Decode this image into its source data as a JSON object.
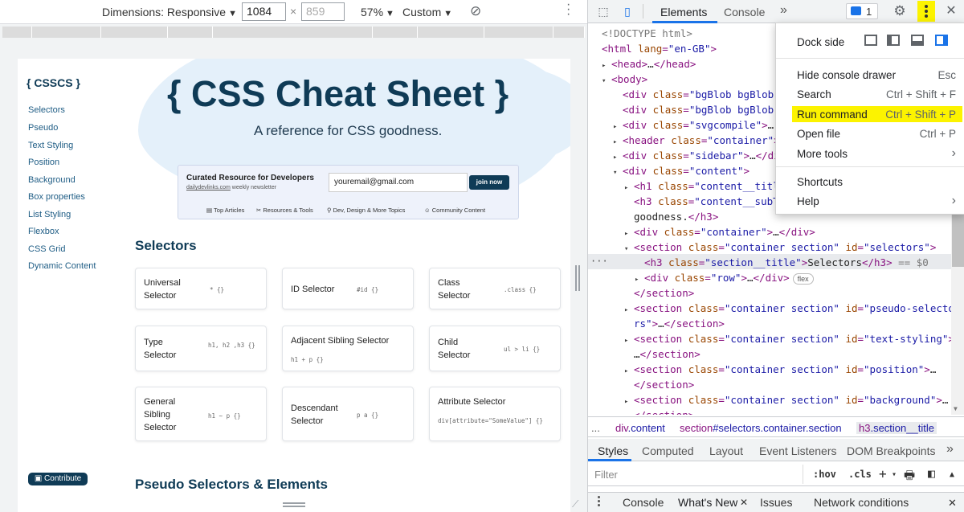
{
  "device_toolbar": {
    "dimensions_label": "Dimensions: Responsive",
    "width_value": "1084",
    "height_placeholder": "859",
    "times": "×",
    "zoom": "57%",
    "throttle": "Custom"
  },
  "site": {
    "logo": "{ CSSCS }",
    "sidebar": [
      "Selectors",
      "Pseudo",
      "Text Styling",
      "Position",
      "Background",
      "Box properties",
      "List Styling",
      "Flexbox",
      "CSS Grid",
      "Dynamic Content"
    ],
    "title": "{ CSS Cheat Sheet }",
    "subtitle": "A reference for CSS goodness.",
    "newsletter": {
      "title": "Curated Resource for Developers",
      "desc_link": "dailydevlinks.com",
      "desc_rest": " weekly newsletter",
      "email_value": "youremail@gmail.com",
      "button": "join now",
      "links": [
        "Top Articles",
        "Resources & Tools",
        "Dev, Design & More Topics",
        "Community Content"
      ]
    },
    "section_selectors": "Selectors",
    "cards": [
      {
        "name": "Universal Selector",
        "code": "* {}"
      },
      {
        "name": "ID Selector",
        "code": "#id {}"
      },
      {
        "name": "Class Selector",
        "code": ".class {}"
      },
      {
        "name": "Type Selector",
        "code": "h1, h2 ,h3 {}"
      },
      {
        "name": "Adjacent Sibling Selector",
        "code": "h1 + p {}"
      },
      {
        "name": "Child Selector",
        "code": "ul > li {}"
      },
      {
        "name": "General Sibling Selector",
        "code": "h1 ~ p {}"
      },
      {
        "name": "Descendant Selector",
        "code": "p a {}"
      },
      {
        "name": "Attribute Selector",
        "code": "div[attribute=\"SomeValue\"] {}"
      }
    ],
    "section_pseudo": "Pseudo Selectors & Elements",
    "contribute": "Contribute"
  },
  "devtools": {
    "tabs": [
      "Elements",
      "Console"
    ],
    "more_tabs": "»",
    "issues_count": "1",
    "close": "✕",
    "menu": {
      "dock_side": "Dock side",
      "items": [
        {
          "label": "Hide console drawer",
          "shortcut": "Esc"
        },
        {
          "label": "Search",
          "shortcut": "Ctrl + Shift + F"
        },
        {
          "label": "Run command",
          "shortcut": "Ctrl + Shift + P"
        },
        {
          "label": "Open file",
          "shortcut": "Ctrl + P"
        },
        {
          "label": "More tools",
          "shortcut": "›"
        },
        {
          "label": "Shortcuts",
          "shortcut": ""
        },
        {
          "label": "Help",
          "shortcut": "›"
        }
      ]
    },
    "code": [
      {
        "tri": "",
        "indent": 0,
        "parts": [
          [
            "cmt",
            "<!DOCTYPE html>"
          ]
        ]
      },
      {
        "tri": "",
        "indent": 0,
        "parts": [
          [
            "tag",
            "<html "
          ],
          [
            "attr",
            "lang"
          ],
          [
            "tag",
            "="
          ],
          [
            "val",
            "\"en-GB\""
          ],
          [
            "tag",
            ">"
          ]
        ]
      },
      {
        "tri": "▸",
        "indent": 1,
        "parts": [
          [
            "tag",
            "<head>"
          ],
          [
            "txt",
            "…"
          ],
          [
            "tag",
            "</head>"
          ]
        ]
      },
      {
        "tri": "▾",
        "indent": 1,
        "parts": [
          [
            "tag",
            "<body>"
          ]
        ]
      },
      {
        "tri": "",
        "indent": 2,
        "parts": [
          [
            "tag",
            "<div "
          ],
          [
            "attr",
            "class"
          ],
          [
            "tag",
            "="
          ],
          [
            "val",
            "\"bgBlob bgBlob-"
          ]
        ]
      },
      {
        "tri": "",
        "indent": 2,
        "parts": [
          [
            "tag",
            "<div "
          ],
          [
            "attr",
            "class"
          ],
          [
            "tag",
            "="
          ],
          [
            "val",
            "\"bgBlob bgBlob-"
          ]
        ]
      },
      {
        "tri": "▸",
        "indent": 2,
        "parts": [
          [
            "tag",
            "<div "
          ],
          [
            "attr",
            "class"
          ],
          [
            "tag",
            "="
          ],
          [
            "val",
            "\"svgcompile\""
          ],
          [
            "tag",
            ">"
          ],
          [
            "txt",
            "…"
          ]
        ]
      },
      {
        "tri": "▸",
        "indent": 2,
        "parts": [
          [
            "tag",
            "<header "
          ],
          [
            "attr",
            "class"
          ],
          [
            "tag",
            "="
          ],
          [
            "val",
            "\"container\""
          ],
          [
            "tag",
            ">"
          ]
        ]
      },
      {
        "tri": "▸",
        "indent": 2,
        "parts": [
          [
            "tag",
            "<div "
          ],
          [
            "attr",
            "class"
          ],
          [
            "tag",
            "="
          ],
          [
            "val",
            "\"sidebar\""
          ],
          [
            "tag",
            ">"
          ],
          [
            "txt",
            "…"
          ],
          [
            "tag",
            "</di"
          ]
        ]
      },
      {
        "tri": "▾",
        "indent": 2,
        "parts": [
          [
            "tag",
            "<div "
          ],
          [
            "attr",
            "class"
          ],
          [
            "tag",
            "="
          ],
          [
            "val",
            "\"content\""
          ],
          [
            "tag",
            ">"
          ]
        ]
      },
      {
        "tri": "▸",
        "indent": 3,
        "parts": [
          [
            "tag",
            "<h1 "
          ],
          [
            "attr",
            "class"
          ],
          [
            "tag",
            "="
          ],
          [
            "val",
            "\"content__titl"
          ]
        ]
      },
      {
        "tri": "",
        "indent": 3,
        "parts": [
          [
            "tag",
            "<h3 "
          ],
          [
            "attr",
            "class"
          ],
          [
            "tag",
            "="
          ],
          [
            "val",
            "\"content__subT"
          ]
        ]
      },
      {
        "tri": "",
        "indent": 3,
        "parts": [
          [
            "txt",
            "goodness."
          ],
          [
            "tag",
            "</h3>"
          ]
        ]
      },
      {
        "tri": "▸",
        "indent": 3,
        "parts": [
          [
            "tag",
            "<div "
          ],
          [
            "attr",
            "class"
          ],
          [
            "tag",
            "="
          ],
          [
            "val",
            "\"container\""
          ],
          [
            "tag",
            ">"
          ],
          [
            "txt",
            "…"
          ],
          [
            "tag",
            "</div>"
          ]
        ]
      },
      {
        "tri": "▾",
        "indent": 3,
        "parts": [
          [
            "tag",
            "<section "
          ],
          [
            "attr",
            "class"
          ],
          [
            "tag",
            "="
          ],
          [
            "val",
            "\"container section\""
          ],
          [
            "txt",
            " "
          ],
          [
            "attr",
            "id"
          ],
          [
            "tag",
            "="
          ],
          [
            "val",
            "\"selectors\""
          ],
          [
            "tag",
            ">"
          ]
        ]
      },
      {
        "tri": "",
        "indent": 4,
        "parts": [
          [
            "tag",
            "<h3 "
          ],
          [
            "attr",
            "class"
          ],
          [
            "tag",
            "="
          ],
          [
            "val",
            "\"section__title\""
          ],
          [
            "tag",
            ">"
          ],
          [
            "txt",
            "Selectors"
          ],
          [
            "tag",
            "</h3>"
          ],
          [
            "cmt",
            " == $0"
          ]
        ]
      },
      {
        "tri": "▸",
        "indent": 4,
        "parts": [
          [
            "tag",
            "<div "
          ],
          [
            "attr",
            "class"
          ],
          [
            "tag",
            "="
          ],
          [
            "val",
            "\"row\""
          ],
          [
            "tag",
            ">"
          ],
          [
            "txt",
            "…"
          ],
          [
            "tag",
            "</div>"
          ],
          [
            "badge",
            "flex"
          ]
        ]
      },
      {
        "tri": "",
        "indent": 3,
        "parts": [
          [
            "tag",
            "</section>"
          ]
        ]
      },
      {
        "tri": "▸",
        "indent": 3,
        "parts": [
          [
            "tag",
            "<section "
          ],
          [
            "attr",
            "class"
          ],
          [
            "tag",
            "="
          ],
          [
            "val",
            "\"container section\""
          ],
          [
            "txt",
            " "
          ],
          [
            "attr",
            "id"
          ],
          [
            "tag",
            "="
          ],
          [
            "val",
            "\"pseudo-selecto"
          ]
        ]
      },
      {
        "tri": "",
        "indent": 3,
        "parts": [
          [
            "val",
            "rs\""
          ],
          [
            "tag",
            ">"
          ],
          [
            "txt",
            "…"
          ],
          [
            "tag",
            "</section>"
          ]
        ]
      },
      {
        "tri": "▸",
        "indent": 3,
        "parts": [
          [
            "tag",
            "<section "
          ],
          [
            "attr",
            "class"
          ],
          [
            "tag",
            "="
          ],
          [
            "val",
            "\"container section\""
          ],
          [
            "txt",
            " "
          ],
          [
            "attr",
            "id"
          ],
          [
            "tag",
            "="
          ],
          [
            "val",
            "\"text-styling\""
          ],
          [
            "tag",
            ">"
          ]
        ]
      },
      {
        "tri": "",
        "indent": 3,
        "parts": [
          [
            "txt",
            "…"
          ],
          [
            "tag",
            "</section>"
          ]
        ]
      },
      {
        "tri": "▸",
        "indent": 3,
        "parts": [
          [
            "tag",
            "<section "
          ],
          [
            "attr",
            "class"
          ],
          [
            "tag",
            "="
          ],
          [
            "val",
            "\"container section\""
          ],
          [
            "txt",
            " "
          ],
          [
            "attr",
            "id"
          ],
          [
            "tag",
            "="
          ],
          [
            "val",
            "\"position\""
          ],
          [
            "tag",
            ">"
          ],
          [
            "txt",
            "…"
          ]
        ]
      },
      {
        "tri": "",
        "indent": 3,
        "parts": [
          [
            "tag",
            "</section>"
          ]
        ]
      },
      {
        "tri": "▸",
        "indent": 3,
        "parts": [
          [
            "tag",
            "<section "
          ],
          [
            "attr",
            "class"
          ],
          [
            "tag",
            "="
          ],
          [
            "val",
            "\"container section\""
          ],
          [
            "txt",
            " "
          ],
          [
            "attr",
            "id"
          ],
          [
            "tag",
            "="
          ],
          [
            "val",
            "\"background\""
          ],
          [
            "tag",
            ">"
          ],
          [
            "txt",
            "…"
          ]
        ]
      },
      {
        "tri": "",
        "indent": 3,
        "parts": [
          [
            "tag",
            "</section>"
          ]
        ]
      }
    ],
    "breadcrumb": [
      {
        "tag": "div",
        "rest": ".content"
      },
      {
        "tag": "section",
        "rest": "#selectors.container.section"
      },
      {
        "tag": "h3",
        "rest": ".section__title"
      }
    ],
    "styles_tabs": [
      "Styles",
      "Computed",
      "Layout",
      "Event Listeners",
      "DOM Breakpoints"
    ],
    "styles_more": "»",
    "filter_placeholder": "Filter",
    "filter_tools": [
      ":hov",
      ".cls",
      "+"
    ],
    "drawer": [
      "Console",
      "What's New",
      "Issues",
      "Network conditions"
    ],
    "drawer_close": "✕"
  },
  "colors": {
    "brand": "#0f3b56",
    "highlight": "#fcf300",
    "devtools_accent": "#1a73e8"
  }
}
